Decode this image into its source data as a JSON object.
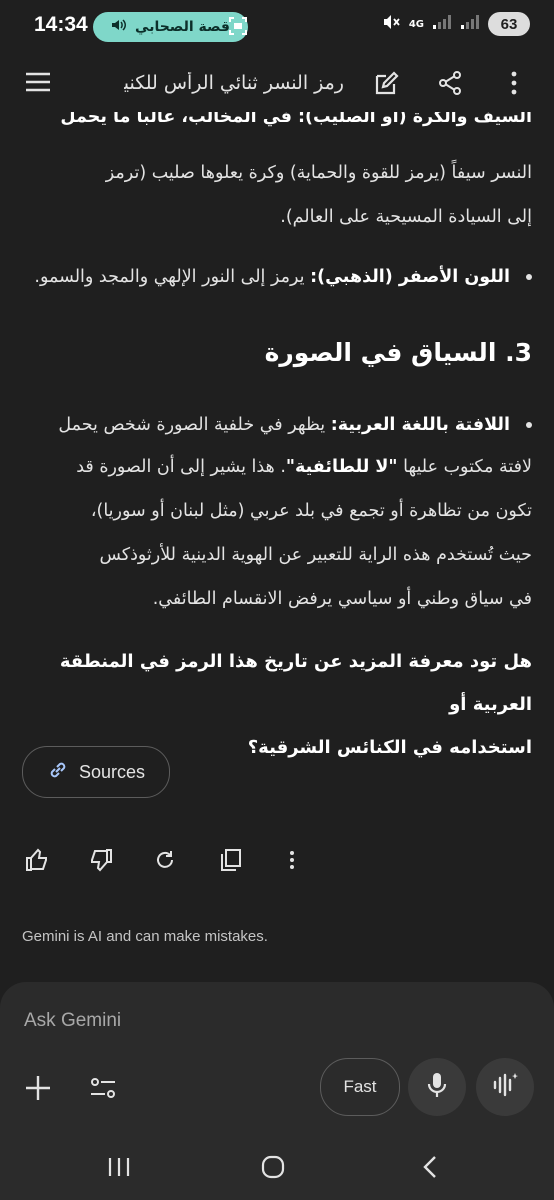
{
  "status_bar": {
    "time": "14:34",
    "pill_label": "قصة الصحابي",
    "network": "4G",
    "battery": "63"
  },
  "app_bar": {
    "title": "رمز النسر ثنائي الرأس للكنيسة ا..."
  },
  "content": {
    "partial_line": "السيف والكرة (أو الصليب): في المخالب، غالباً ما يحمل",
    "para1_line1": "النسر سيفاً (يرمز للقوة والحماية) وكرة يعلوها صليب (ترمز",
    "para1_line2": "إلى السيادة المسيحية على العالم).",
    "bullet_gold_label": "اللون الأصفر (الذهبي):",
    "bullet_gold_text": " يرمز إلى النور الإلهي والمجد والسمو.",
    "section_heading": "3. السياق في الصورة",
    "bullet_banner_label": "اللافتة باللغة العربية:",
    "bullet_banner_text1": " يظهر في خلفية الصورة شخص يحمل",
    "bullet_banner_line2a": "لافتة مكتوب عليها ",
    "bullet_banner_quote": "\"لا للطائفية\"",
    "bullet_banner_line2b": ". هذا يشير إلى أن الصورة قد",
    "bullet_banner_line3": "تكون من تظاهرة أو تجمع في بلد عربي (مثل لبنان أو سوريا)،",
    "bullet_banner_line4": "حيث تُستخدم هذه الراية للتعبير عن الهوية الدينية للأرثوذكس",
    "bullet_banner_line5": "في سياق وطني أو سياسي يرفض الانقسام الطائفي.",
    "question_line1": "هل تود معرفة المزيد عن تاريخ هذا الرمز في المنطقة العربية أو",
    "question_line2": "استخدامه في الكنائس الشرقية؟",
    "sources_label": "Sources",
    "disclaimer": "Gemini is AI and can make mistakes."
  },
  "input": {
    "placeholder": "Ask Gemini",
    "fast_label": "Fast"
  }
}
